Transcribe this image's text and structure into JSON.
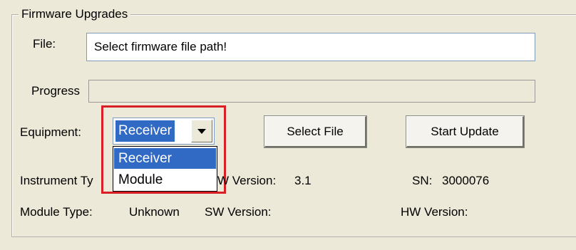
{
  "group": {
    "title": "Firmware Upgrades"
  },
  "file": {
    "label": "File:",
    "value": "Select firmware file path!"
  },
  "progress": {
    "label": "Progress"
  },
  "equipment": {
    "label": "Equipment:",
    "selected": "Receiver",
    "options": [
      "Receiver",
      "Module"
    ]
  },
  "buttons": {
    "select_file": "Select File",
    "start_update": "Start Update"
  },
  "info": {
    "instrument_type_label": "Instrument Ty",
    "sw_version_label": "W Version:",
    "sw_version_value": "3.1",
    "sn_label": "SN:",
    "sn_value": "3000076",
    "module_type_label": "Module Type:",
    "module_type_value": "Unknown",
    "module_sw_version_label": "SW Version:",
    "hw_version_label": "HW Version:"
  },
  "colors": {
    "background": "#ece9d8",
    "highlight": "#316ac5",
    "annotation_red": "#d91f26"
  }
}
